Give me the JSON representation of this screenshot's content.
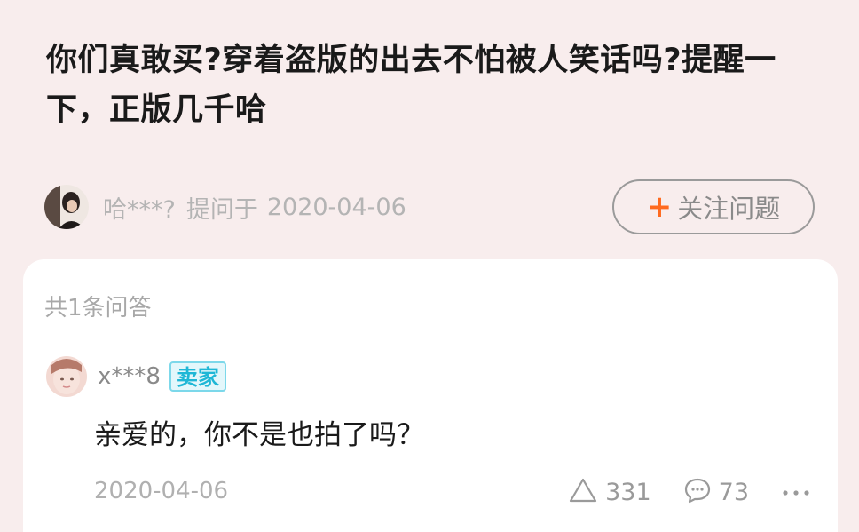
{
  "question": {
    "title": "你们真敢买?穿着盗版的出去不怕被人笑话吗?提醒一下，正版几千哈",
    "asker_name": "哈***?",
    "asked_label": "提问于",
    "asked_date": "2020-04-06",
    "follow_label": "关注问题"
  },
  "answers": {
    "count_label": "共1条问答",
    "items": [
      {
        "user_name": "x***8",
        "badge": "卖家",
        "text": "亲爱的，你不是也拍了吗？",
        "date": "2020-04-06",
        "like_count": "331",
        "comment_count": "73"
      }
    ]
  },
  "colors": {
    "background": "#f8eded",
    "accent_plus": "#ff6a1f",
    "seller_badge": "#1fb7d6"
  },
  "icons": [
    "plus-icon",
    "like-triangle-icon",
    "comment-bubble-icon",
    "more-dots-icon"
  ]
}
